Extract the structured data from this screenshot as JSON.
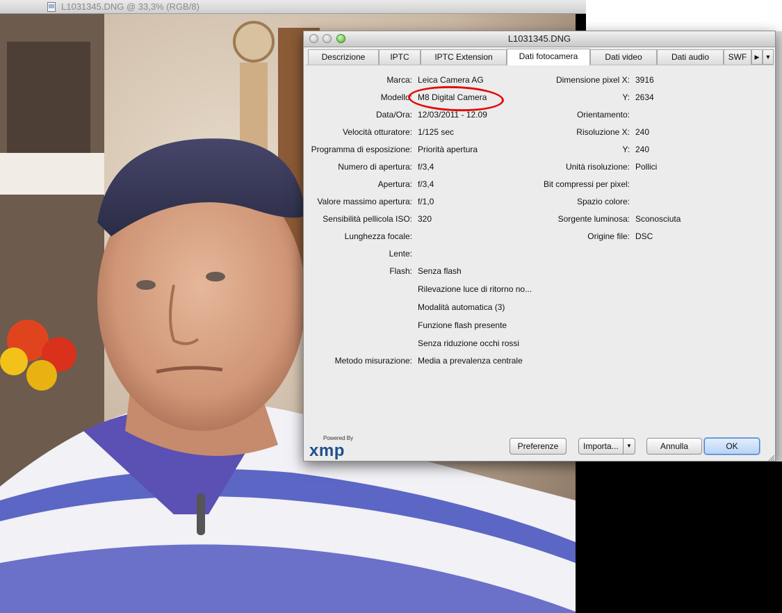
{
  "photoshop": {
    "document_title": "L1031345.DNG @ 33,3% (RGB/8)"
  },
  "dialog": {
    "title": "L1031345.DNG",
    "tabs": [
      {
        "label": "Descrizione"
      },
      {
        "label": "IPTC"
      },
      {
        "label": "IPTC Extension"
      },
      {
        "label": "Dati fotocamera",
        "active": true
      },
      {
        "label": "Dati video"
      },
      {
        "label": "Dati audio"
      },
      {
        "label": "SWF"
      }
    ],
    "left_fields": [
      {
        "label": "Marca:",
        "value": "Leica Camera AG"
      },
      {
        "label": "Modello:",
        "value": "M8 Digital Camera"
      },
      {
        "label": "Data/Ora:",
        "value": "12/03/2011 - 12.09"
      },
      {
        "label": "Velocità otturatore:",
        "value": "1/125 sec"
      },
      {
        "label": "Programma di esposizione:",
        "value": "Priorità apertura"
      },
      {
        "label": "Numero di apertura:",
        "value": "f/3,4"
      },
      {
        "label": "Apertura:",
        "value": "f/3,4"
      },
      {
        "label": "Valore massimo apertura:",
        "value": "f/1,0"
      },
      {
        "label": "Sensibilità pellicola ISO:",
        "value": "320"
      },
      {
        "label": "Lunghezza focale:",
        "value": ""
      },
      {
        "label": "Lente:",
        "value": ""
      },
      {
        "label": "Flash:",
        "value": "Senza flash"
      }
    ],
    "flash_details": [
      "Rilevazione luce di ritorno no...",
      "Modalità automatica (3)",
      "Funzione flash presente",
      "Senza riduzione occhi rossi"
    ],
    "metering": {
      "label": "Metodo misurazione:",
      "value": "Media a prevalenza centrale"
    },
    "right_fields": [
      {
        "label": "Dimensione pixel X:",
        "value": "3916"
      },
      {
        "label": "Y:",
        "value": "2634"
      },
      {
        "label": "Orientamento:",
        "value": ""
      },
      {
        "label": "Risoluzione X:",
        "value": "240"
      },
      {
        "label": "Y:",
        "value": "240"
      },
      {
        "label": "Unità risoluzione:",
        "value": "Pollici"
      },
      {
        "label": "Bit compressi per pixel:",
        "value": ""
      },
      {
        "label": "Spazio colore:",
        "value": ""
      },
      {
        "label": "Sorgente luminosa:",
        "value": "Sconosciuta"
      },
      {
        "label": "Origine file:",
        "value": "DSC"
      }
    ],
    "logo": {
      "powered_by": "Powered By",
      "name": "xmp"
    },
    "buttons": {
      "preferences": "Preferenze",
      "import": "Importa...",
      "cancel": "Annulla",
      "ok": "OK"
    }
  }
}
